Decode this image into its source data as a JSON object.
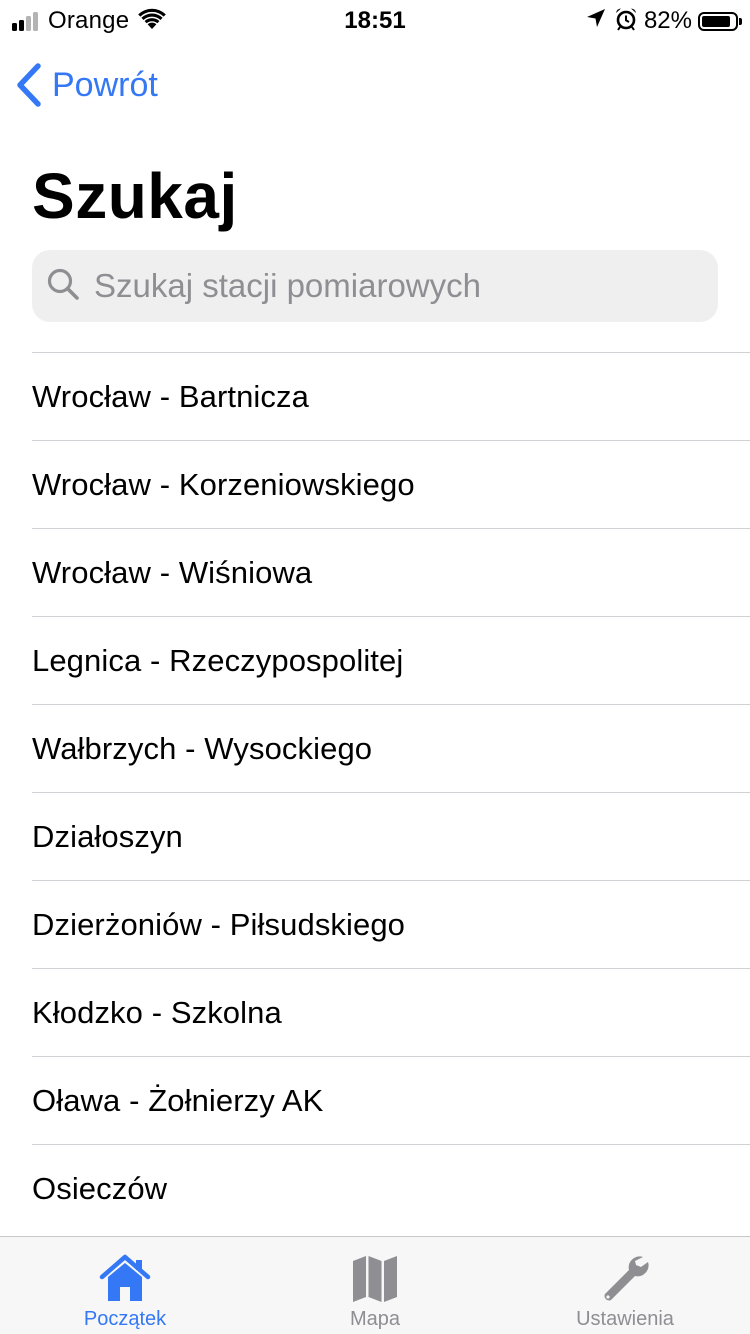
{
  "status_bar": {
    "carrier": "Orange",
    "time": "18:51",
    "battery_percent": "82%",
    "battery_level": 0.82,
    "signal_bars": 4,
    "signal_bars_filled": 2
  },
  "nav": {
    "back_label": "Powrót"
  },
  "page": {
    "title": "Szukaj"
  },
  "search": {
    "placeholder": "Szukaj stacji pomiarowych",
    "value": ""
  },
  "stations": [
    {
      "label": "Wrocław - Bartnicza"
    },
    {
      "label": "Wrocław - Korzeniowskiego"
    },
    {
      "label": "Wrocław - Wiśniowa"
    },
    {
      "label": "Legnica - Rzeczypospolitej"
    },
    {
      "label": "Wałbrzych - Wysockiego"
    },
    {
      "label": "Działoszyn"
    },
    {
      "label": "Dzierżoniów - Piłsudskiego"
    },
    {
      "label": "Kłodzko - Szkolna"
    },
    {
      "label": "Oława - Żołnierzy AK"
    },
    {
      "label": "Osieczów"
    }
  ],
  "tab_bar": {
    "tabs": [
      {
        "label": "Początek",
        "icon": "house-icon",
        "active": true
      },
      {
        "label": "Mapa",
        "icon": "map-icon",
        "active": false
      },
      {
        "label": "Ustawienia",
        "icon": "wrench-icon",
        "active": false
      }
    ]
  },
  "colors": {
    "accent": "#3478f6",
    "inactive": "#8e8e93",
    "search_background": "#efeff0",
    "separator": "#d2d2d6"
  }
}
